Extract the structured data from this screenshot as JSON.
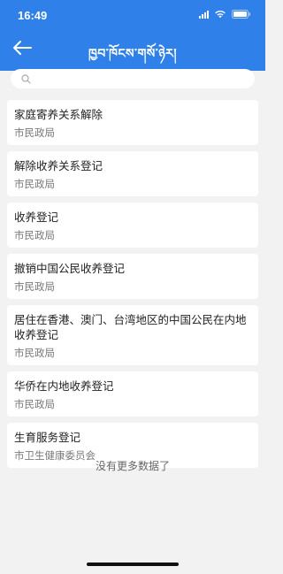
{
  "status_bar": {
    "time": "16:49"
  },
  "nav": {
    "title": "ཁྱབ་ཁོངས་གསོ་ཉེར།"
  },
  "search": {
    "placeholder": ""
  },
  "items": [
    {
      "title": "家庭寄养关系解除",
      "subtitle": "市民政局"
    },
    {
      "title": "解除收养关系登记",
      "subtitle": "市民政局"
    },
    {
      "title": "收养登记",
      "subtitle": "市民政局"
    },
    {
      "title": "撤销中国公民收养登记",
      "subtitle": "市民政局"
    },
    {
      "title": "居住在香港、澳门、台湾地区的中国公民在内地收养登记",
      "subtitle": "市民政局"
    },
    {
      "title": "华侨在内地收养登记",
      "subtitle": "市民政局"
    },
    {
      "title": "生育服务登记",
      "subtitle": "市卫生健康委员会"
    }
  ],
  "footer": {
    "no_more": "没有更多数据了"
  },
  "colors": {
    "header_bg": "#2f80e8",
    "page_bg": "#f2f2f2",
    "card_bg": "#ffffff"
  }
}
